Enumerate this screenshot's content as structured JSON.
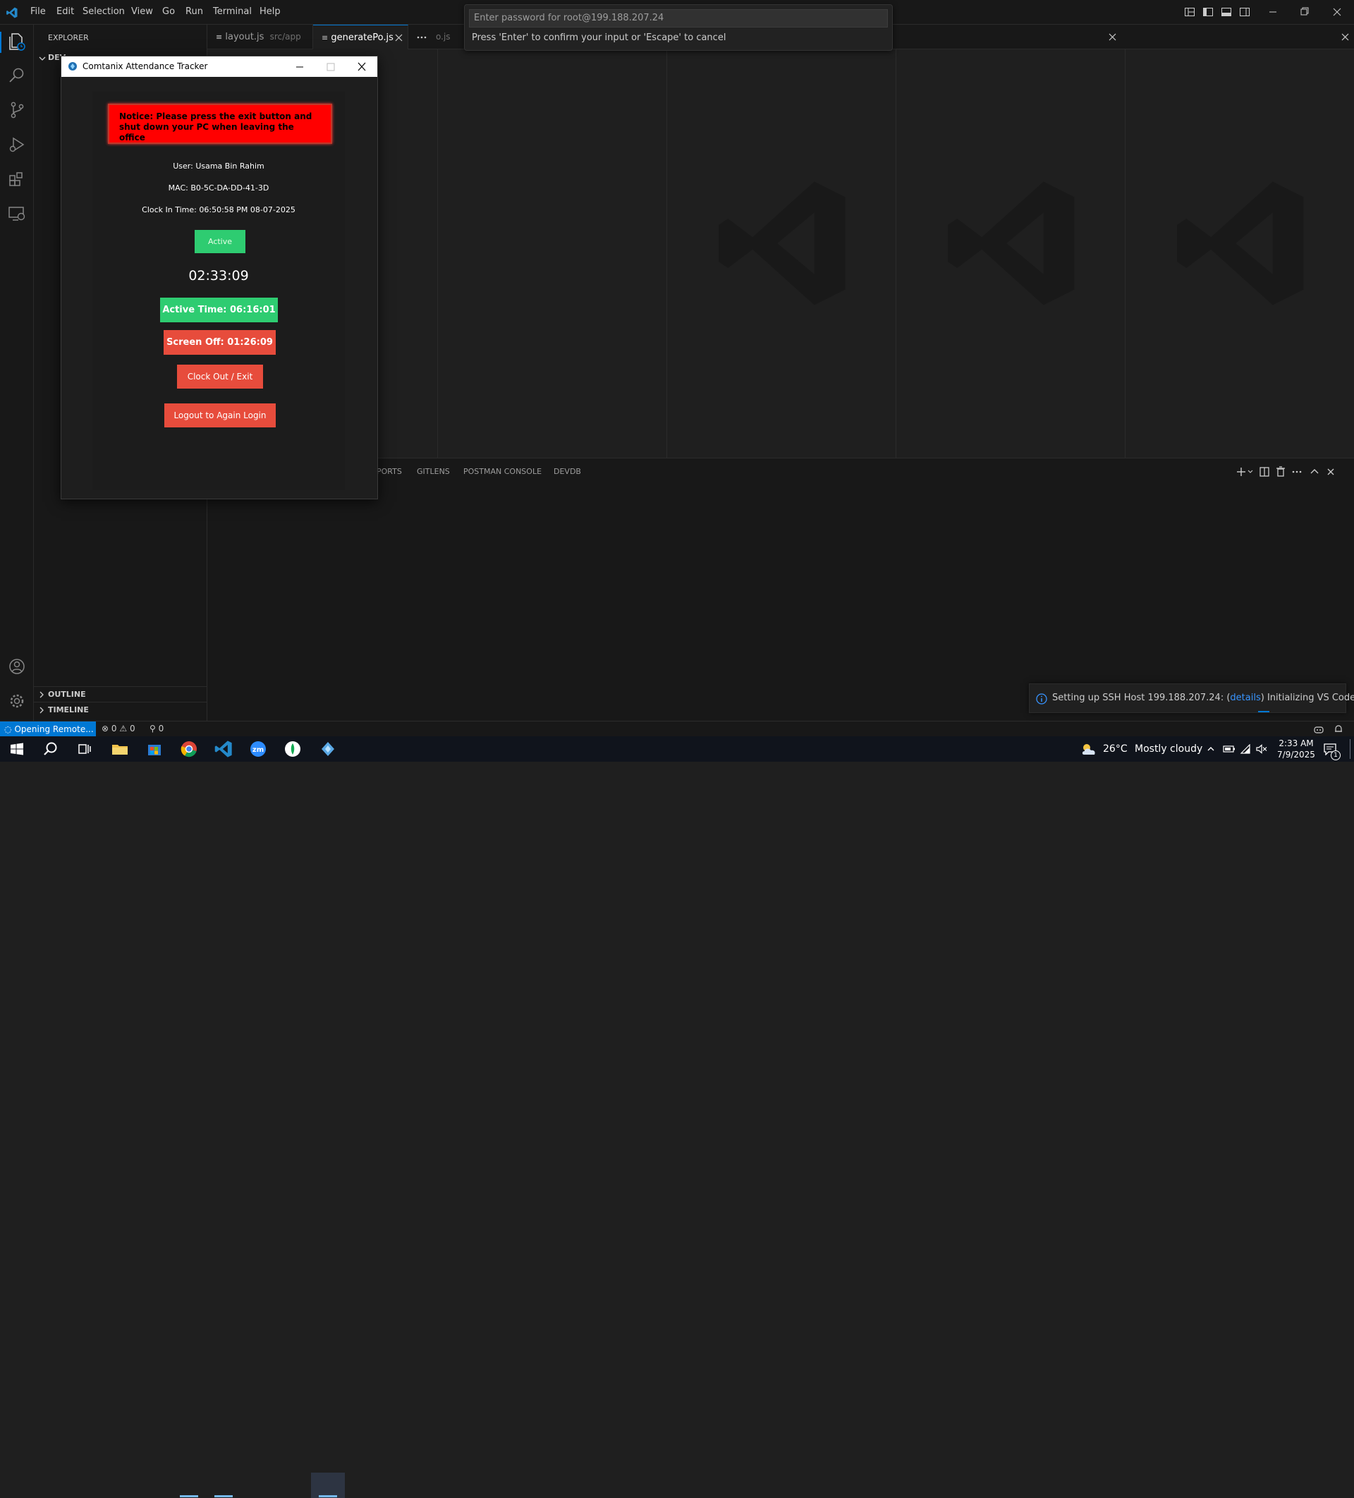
{
  "menu": {
    "file": "File",
    "edit": "Edit",
    "selection": "Selection",
    "view": "View",
    "go": "Go",
    "run": "Run",
    "terminal": "Terminal",
    "help": "Help"
  },
  "quick_input": {
    "placeholder": "Enter password for root@199.188.207.24",
    "message": "Press 'Enter' to confirm your input or 'Escape' to cancel"
  },
  "sidebar": {
    "title": "EXPLORER",
    "section_partial": "DEV",
    "outline": "OUTLINE",
    "timeline": "TIMELINE"
  },
  "tabs": [
    {
      "label": "layout.js",
      "sub": "src/app"
    },
    {
      "label": "generatePo.js",
      "sub": ""
    },
    {
      "label": "o.js",
      "sub": ""
    }
  ],
  "panel": {
    "tab_ports_partial": "PORTS",
    "tab_gitlens": "GITLENS",
    "tab_postman": "POSTMAN CONSOLE",
    "tab_devdb": "DEVDB"
  },
  "tracker": {
    "window_title": "Comtanix Attendance Tracker",
    "notice": "Notice: Please press the exit button and shut down your PC when leaving the office",
    "user": "User: Usama Bin Rahim",
    "mac": "MAC: B0-5C-DA-DD-41-3D",
    "clock_in": "Clock In Time: 06:50:58 PM 08-07-2025",
    "status": "Active",
    "timer": "02:33:09",
    "active_time": "Active Time: 06:16:01",
    "screen_off": "Screen Off: 01:26:09",
    "clock_out": "Clock Out / Exit",
    "logout": "Logout to Again Login"
  },
  "notification": {
    "prefix": "Setting up SSH Host 199.188.207.24: (",
    "link": "details",
    "suffix": ") Initializing VS Code Server"
  },
  "statusbar": {
    "remote": "Opening Remote...",
    "errors": "0",
    "warnings": "0",
    "ports": "0"
  },
  "taskbar": {
    "weather_temp": "26°C",
    "weather_desc": "Mostly cloudy",
    "time": "2:33 AM",
    "date": "7/9/2025",
    "notifications": "1"
  },
  "colors": {
    "accent": "#0078d4",
    "notice_red": "#ff0000",
    "green": "#2ecc71",
    "red": "#e74c3c"
  }
}
